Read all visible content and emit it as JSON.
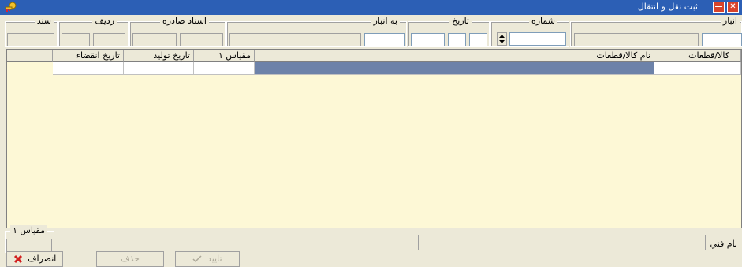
{
  "window": {
    "title": "ثبت نقل و انتقال",
    "close_glyph": "✕",
    "minimize_glyph": "—",
    "titlebar_color": "#2c5fb5"
  },
  "header": {
    "anbar_label": "انبار",
    "shomare_label": "شماره",
    "tarikh_label": "تاريخ",
    "be_anbar_label": "به انبار",
    "asnad_sadere_label": "اسناد صادره",
    "radif_label": "رديف",
    "sanad_label": "سند"
  },
  "grid": {
    "columns": [
      "كالا/قطعات",
      "نام كالا/قطعات",
      "مقياس ۱",
      "تاريخ توليد",
      "تاريخ انقضاء"
    ],
    "background": "#fdf8d6",
    "selection_color": "#6d82a9"
  },
  "bottom": {
    "name_fanni_label": "نام فني",
    "meqyas_label": "مقياس ۱"
  },
  "buttons": {
    "cancel_label": "انصراف",
    "delete_label": "حذف",
    "confirm_label": "تاييد"
  }
}
